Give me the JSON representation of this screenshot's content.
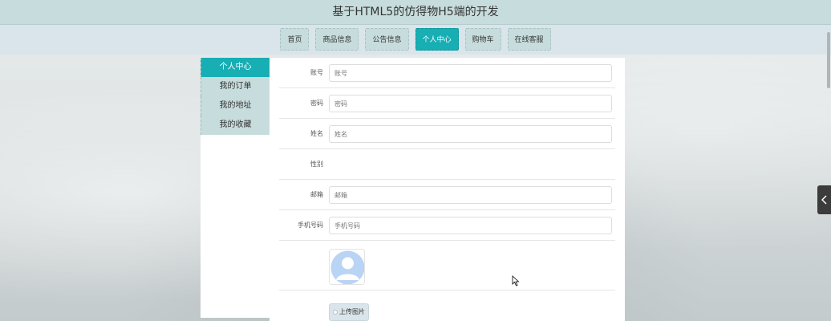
{
  "site": {
    "title": "基于HTML5的仿得物H5端的开发"
  },
  "nav": {
    "items": [
      {
        "label": "首页"
      },
      {
        "label": "商品信息"
      },
      {
        "label": "公告信息"
      },
      {
        "label": "个人中心"
      },
      {
        "label": "购物车"
      },
      {
        "label": "在线客服"
      }
    ],
    "active_label": "个人中心"
  },
  "sidebar": {
    "items": [
      {
        "label": "个人中心"
      },
      {
        "label": "我的订单"
      },
      {
        "label": "我的地址"
      },
      {
        "label": "我的收藏"
      }
    ]
  },
  "form": {
    "account": {
      "label": "账号",
      "placeholder": "账号"
    },
    "password": {
      "label": "密码",
      "placeholder": "密码"
    },
    "name": {
      "label": "姓名",
      "placeholder": "姓名"
    },
    "gender": {
      "label": "性别"
    },
    "email": {
      "label": "邮箱",
      "placeholder": "邮箱"
    },
    "phone": {
      "label": "手机号码",
      "placeholder": "手机号码"
    },
    "upload_label": "上传图片"
  },
  "colors": {
    "accent": "#17aeb4",
    "nav_bg": "#c7dcdc",
    "header_bg": "#c7dcdc"
  },
  "icons": {
    "avatar": "avatar-placeholder-icon",
    "toggle": "chevron-left-icon"
  }
}
